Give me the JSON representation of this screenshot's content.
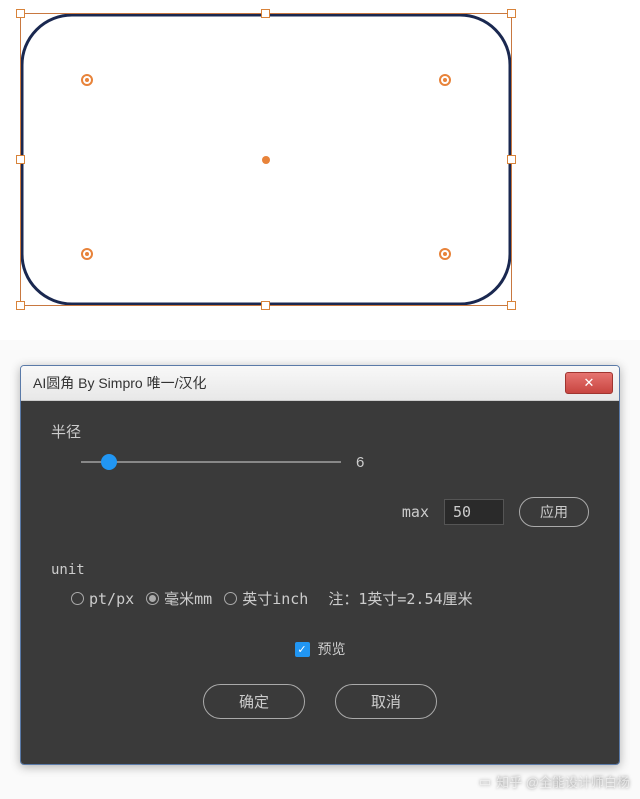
{
  "dialog": {
    "title": "AI圆角 By Simpro 唯一/汉化",
    "radius": {
      "label": "半径",
      "value": "6",
      "max_label": "max",
      "max_value": "50",
      "apply": "应用"
    },
    "unit": {
      "label": "unit",
      "options": [
        "pt/px",
        "毫米mm",
        "英寸inch"
      ],
      "selected": 1,
      "note": "注：1英寸=2.54厘米"
    },
    "preview": {
      "label": "预览",
      "checked": true
    },
    "buttons": {
      "ok": "确定",
      "cancel": "取消"
    }
  },
  "watermark": "知乎 @全能设计师白杨"
}
